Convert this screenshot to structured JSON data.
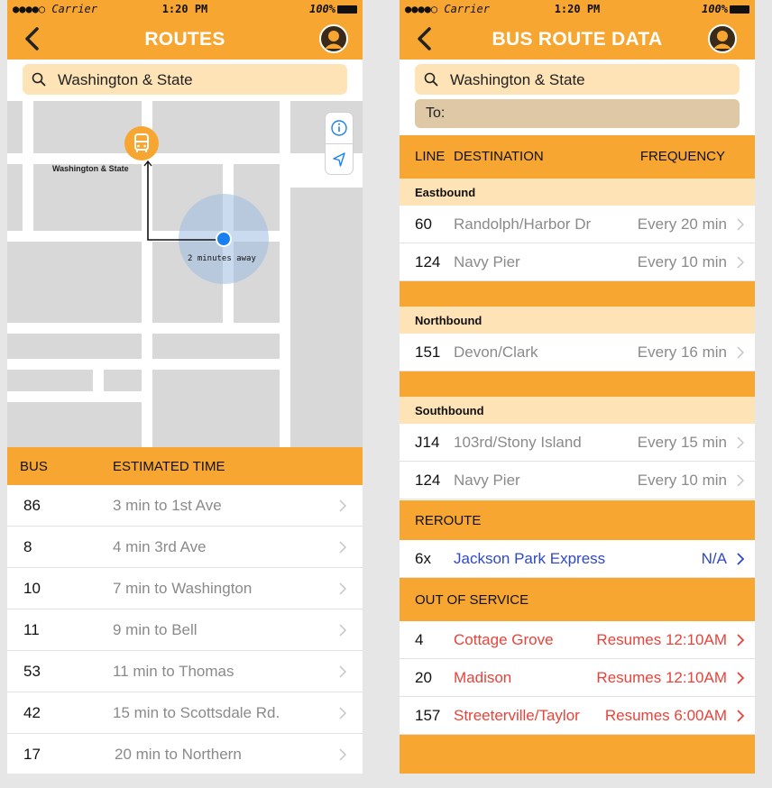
{
  "status_bar": {
    "carrier": "●●●●○ Carrier",
    "time": "1:20 PM",
    "battery": "100%"
  },
  "routes_screen": {
    "title": "ROUTES",
    "search_value": "Washington & State",
    "map": {
      "stop_label": "Washington & State",
      "eta_label": "2 minutes away"
    },
    "table": {
      "col_bus": "BUS",
      "col_time": "ESTIMATED TIME",
      "rows": [
        {
          "bus": "86",
          "time": "3 min to 1st Ave"
        },
        {
          "bus": "8",
          "time": "4 min 3rd Ave"
        },
        {
          "bus": "10",
          "time": "7 min to Washington"
        },
        {
          "bus": "11",
          "time": "9 min to Bell"
        },
        {
          "bus": "53",
          "time": "11 min to Thomas"
        },
        {
          "bus": "42",
          "time": "15 min to Scottsdale Rd."
        },
        {
          "bus": "17",
          "time": "20 min to Northern"
        }
      ]
    }
  },
  "route_data_screen": {
    "title": "BUS ROUTE DATA",
    "search_value": "Washington & State",
    "to_placeholder": "To:",
    "headers": {
      "line": "LINE",
      "destination": "DESTINATION",
      "frequency": "FREQUENCY"
    },
    "eastbound": {
      "label": "Eastbound",
      "rows": [
        {
          "line": "60",
          "destination": "Randolph/Harbor Dr",
          "frequency": "Every 20 min"
        },
        {
          "line": "124",
          "destination": "Navy Pier",
          "frequency": "Every 10 min"
        }
      ]
    },
    "northbound": {
      "label": "Northbound",
      "rows": [
        {
          "line": "151",
          "destination": "Devon/Clark",
          "frequency": "Every 16 min"
        }
      ]
    },
    "southbound": {
      "label": "Southbound",
      "rows": [
        {
          "line": "J14",
          "destination": "103rd/Stony Island",
          "frequency": "Every 15 min"
        },
        {
          "line": "124",
          "destination": "Navy Pier",
          "frequency": "Every 10 min"
        }
      ]
    },
    "reroute": {
      "label": "REROUTE",
      "rows": [
        {
          "line": "6x",
          "destination": "Jackson Park Express",
          "frequency": "N/A"
        }
      ]
    },
    "out_of_service": {
      "label": "OUT OF SERVICE",
      "rows": [
        {
          "line": "4",
          "destination": "Cottage Grove",
          "frequency": "Resumes 12:10AM"
        },
        {
          "line": "20",
          "destination": "Madison",
          "frequency": "Resumes 12:10AM"
        },
        {
          "line": "157",
          "destination": "Streeterville/Taylor",
          "frequency": "Resumes 6:00AM"
        }
      ]
    }
  },
  "colors": {
    "accent": "#f7a632",
    "section": "#fde3b5",
    "reroute_text": "#3048c8",
    "out_of_service_text": "#e8433a"
  },
  "icons": [
    "back-chevron-icon",
    "user-avatar-icon",
    "search-icon",
    "info-icon",
    "location-arrow-icon",
    "bus-icon",
    "chevron-right-icon"
  ]
}
